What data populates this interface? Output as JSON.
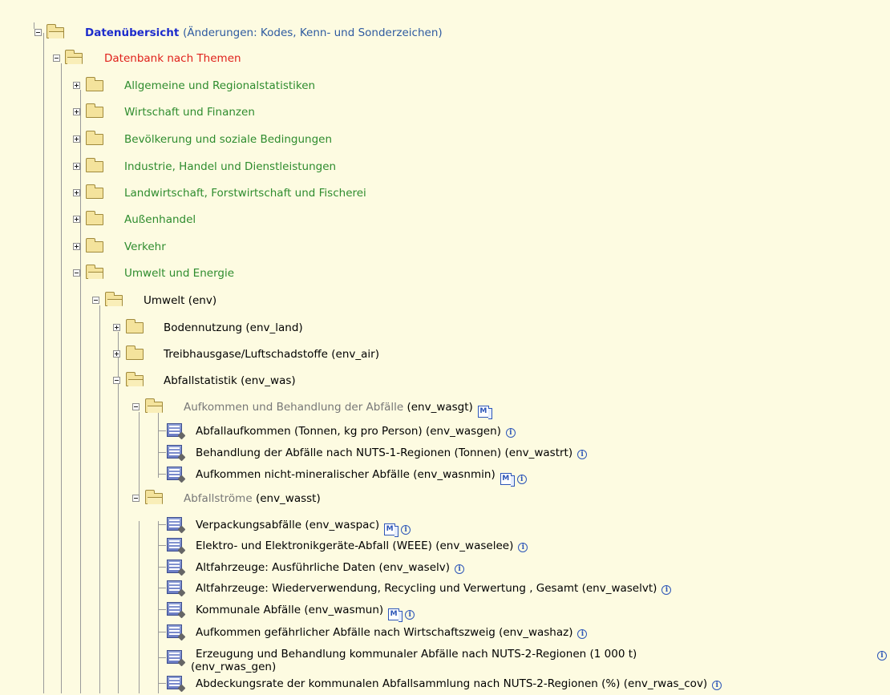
{
  "tree": {
    "root": {
      "title": "Datenübersicht",
      "subtitle": "(Änderungen: Kodes, Kenn- und Sonderzeichen)"
    },
    "db_themes": "Datenbank nach Themen",
    "themes": [
      "Allgemeine und Regionalstatistiken",
      "Wirtschaft und Finanzen",
      "Bevölkerung und soziale Bedingungen",
      "Industrie, Handel und Dienstleistungen",
      "Landwirtschaft, Forstwirtschaft und Fischerei",
      "Außenhandel",
      "Verkehr",
      "Umwelt und Energie"
    ],
    "env": "Umwelt (env)",
    "env_children": [
      "Bodennutzung (env_land)",
      "Treibhausgase/Luftschadstoffe (env_air)",
      "Abfallstatistik (env_was)"
    ],
    "wasgt": {
      "name": "Aufkommen und Behandlung der Abfälle",
      "code": "(env_wasgt)"
    },
    "wasgt_items": [
      "Abfallaufkommen (Tonnen, kg pro Person) (env_wasgen)",
      "Behandlung der Abfälle nach NUTS-1-Regionen (Tonnen) (env_wastrt)",
      "Aufkommen nicht-mineralischer Abfälle (env_wasnmin)"
    ],
    "wasst": {
      "name": "Abfallströme",
      "code": "(env_wasst)"
    },
    "wasst_items": [
      "Verpackungsabfälle (env_waspac)",
      "Elektro- und Elektronikgeräte-Abfall (WEEE) (env_waselee)",
      "Altfahrzeuge: Ausführliche Daten (env_waselv)",
      "Altfahrzeuge: Wiederverwendung, Recycling und Verwertung , Gesamt (env_waselvt)",
      "Kommunale Abfälle (env_wasmun)",
      "Aufkommen gefährlicher Abfälle nach Wirtschaftszweig (env_washaz)",
      "Erzeugung und Behandlung kommunaler Abfälle nach NUTS-2-Regionen (1 000 t)",
      "(env_rwas_gen)",
      "Abdeckungsrate der kommunalen Abfallsammlung nach NUTS-2-Regionen (%) (env_rwas_cov)"
    ],
    "badges": {
      "metadata": "M",
      "info": "i"
    }
  }
}
